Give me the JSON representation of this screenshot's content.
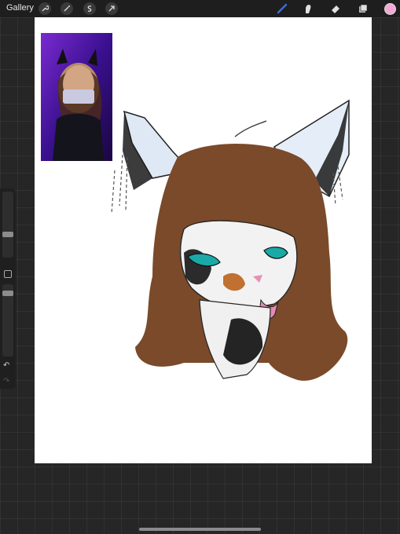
{
  "toolbar": {
    "gallery_label": "Gallery",
    "left_tools": [
      "wrench-icon",
      "magic-wand-icon",
      "selection-icon",
      "transform-arrow-icon"
    ],
    "right_tools": [
      "brush-icon",
      "smudge-icon",
      "eraser-icon",
      "layers-icon"
    ],
    "current_color": "#f4a9d4",
    "brush_color": "#3d6fd8"
  },
  "sidebar": {
    "brush_size": 0.65,
    "opacity": 0.2,
    "undo_symbol": "↶",
    "redo_symbol": "↷"
  },
  "canvas": {
    "background": "#ffffff",
    "reference_image": "selfie-reference-photo",
    "artwork": "cat-character-sketch"
  }
}
